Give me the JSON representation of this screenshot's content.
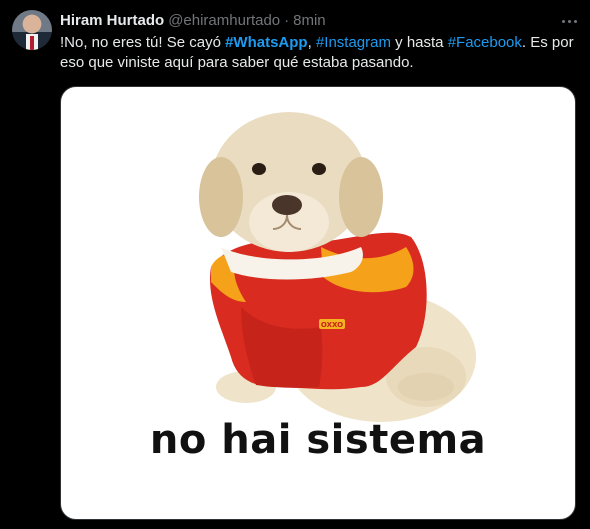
{
  "tweet": {
    "author_name": "Hiram Hurtado",
    "handle": "@ehiramhurtado",
    "separator": "·",
    "time": "8min",
    "text_parts": [
      "!No, no eres tú!  Se cayó ",
      "#WhatsApp",
      ", ",
      "#Instagram",
      " y hasta ",
      "#Facebook",
      ". Es por eso que viniste aquí para saber qué estaba pasando."
    ],
    "media_caption": "no hai sistema",
    "shirt_label": "OXXO"
  },
  "icons": {
    "avatar": "avatar",
    "more": "more-horizontal-icon"
  },
  "colors": {
    "background": "#000000",
    "text": "#e7e9ea",
    "muted": "#71767b",
    "link": "#1d9bf0"
  }
}
